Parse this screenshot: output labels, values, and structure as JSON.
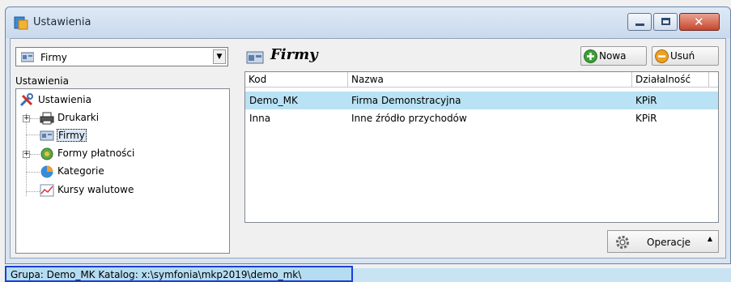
{
  "window": {
    "title": "Ustawienia"
  },
  "left": {
    "combo_value": "Firmy",
    "header": "Ustawienia",
    "tree": {
      "root": "Ustawienia",
      "items": [
        "Drukarki",
        "Firmy",
        "Formy płatności",
        "Kategorie",
        "Kursy walutowe"
      ]
    }
  },
  "right": {
    "title": "Firmy",
    "new_label": "Nowa",
    "delete_label": "Usuń",
    "columns": [
      "Kod",
      "Nazwa",
      "Działalność"
    ],
    "rows": [
      {
        "kod": "Demo_MK",
        "nazwa": "Firma Demonstracyjna",
        "dzialalnosc": "KPiR"
      },
      {
        "kod": "Inna",
        "nazwa": "Inne źródło przychodów",
        "dzialalnosc": "KPiR"
      }
    ],
    "operations_label": "Operacje"
  },
  "status": {
    "text": "Grupa: Demo_MK   Katalog: x:\\symfonia\\mkp2019\\demo_mk\\"
  },
  "colors": {
    "selection": "#b9e2f4",
    "status_border": "#1a3fd6",
    "close_button": "#c7462d"
  }
}
